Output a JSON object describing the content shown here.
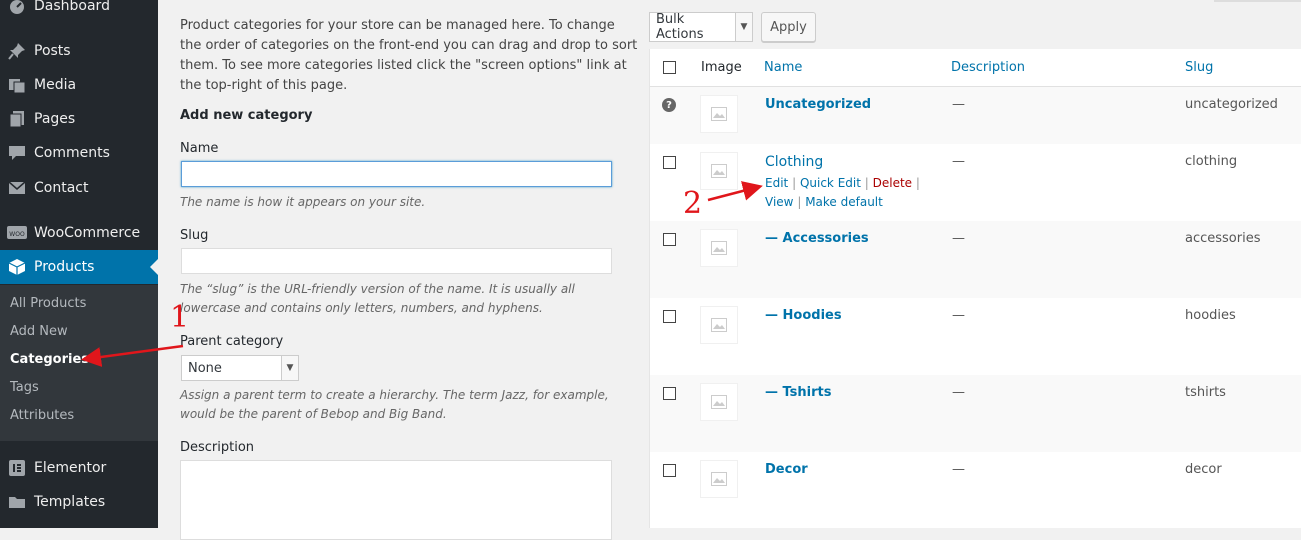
{
  "sidebar": {
    "items": [
      {
        "label": "Dashboard",
        "icon": "dashboard-icon"
      },
      {
        "label": "Posts",
        "icon": "pin-icon"
      },
      {
        "label": "Media",
        "icon": "media-icon"
      },
      {
        "label": "Pages",
        "icon": "pages-icon"
      },
      {
        "label": "Comments",
        "icon": "comment-icon"
      },
      {
        "label": "Contact",
        "icon": "envelope-icon"
      },
      {
        "label": "WooCommerce",
        "icon": "woocommerce-icon"
      },
      {
        "label": "Products",
        "icon": "products-box-icon"
      },
      {
        "label": "Elementor",
        "icon": "elementor-icon"
      },
      {
        "label": "Templates",
        "icon": "folder-icon"
      }
    ],
    "submenu": [
      "All Products",
      "Add New",
      "Categories",
      "Tags",
      "Attributes"
    ],
    "current_sub": "Categories",
    "accent": "#0073aa",
    "bg": "#23282d"
  },
  "form": {
    "intro": "Product categories for your store can be managed here. To change the order of categories on the front-end you can drag and drop to sort them. To see more categories listed click the \"screen options\" link at the top-right of this page.",
    "heading": "Add new category",
    "name_label": "Name",
    "name_value": "",
    "name_help": "The name is how it appears on your site.",
    "slug_label": "Slug",
    "slug_value": "",
    "slug_help": "The “slug” is the URL-friendly version of the name. It is usually all lowercase and contains only letters, numbers, and hyphens.",
    "parent_label": "Parent category",
    "parent_value": "None",
    "parent_help": "Assign a parent term to create a hierarchy. The term Jazz, for example, would be the parent of Bebop and Big Band.",
    "description_label": "Description"
  },
  "toolbar": {
    "bulk_actions": "Bulk Actions",
    "apply": "Apply"
  },
  "table": {
    "headers": {
      "image": "Image",
      "name": "Name",
      "description": "Description",
      "slug": "Slug"
    },
    "rows": [
      {
        "name": "Uncategorized",
        "description": "—",
        "slug": "uncategorized"
      },
      {
        "name": "Clothing",
        "description": "—",
        "slug": "clothing"
      },
      {
        "name": "— Accessories",
        "description": "—",
        "slug": "accessories"
      },
      {
        "name": "— Hoodies",
        "description": "—",
        "slug": "hoodies"
      },
      {
        "name": "— Tshirts",
        "description": "—",
        "slug": "tshirts"
      },
      {
        "name": "Decor",
        "description": "—",
        "slug": "decor"
      }
    ],
    "row_actions": {
      "edit": "Edit",
      "quick_edit": "Quick Edit",
      "delete": "Delete",
      "view": "View",
      "make_default": "Make default",
      "separator": "|"
    }
  },
  "annotations": {
    "one": "1",
    "two": "2",
    "color": "#e0161b"
  }
}
